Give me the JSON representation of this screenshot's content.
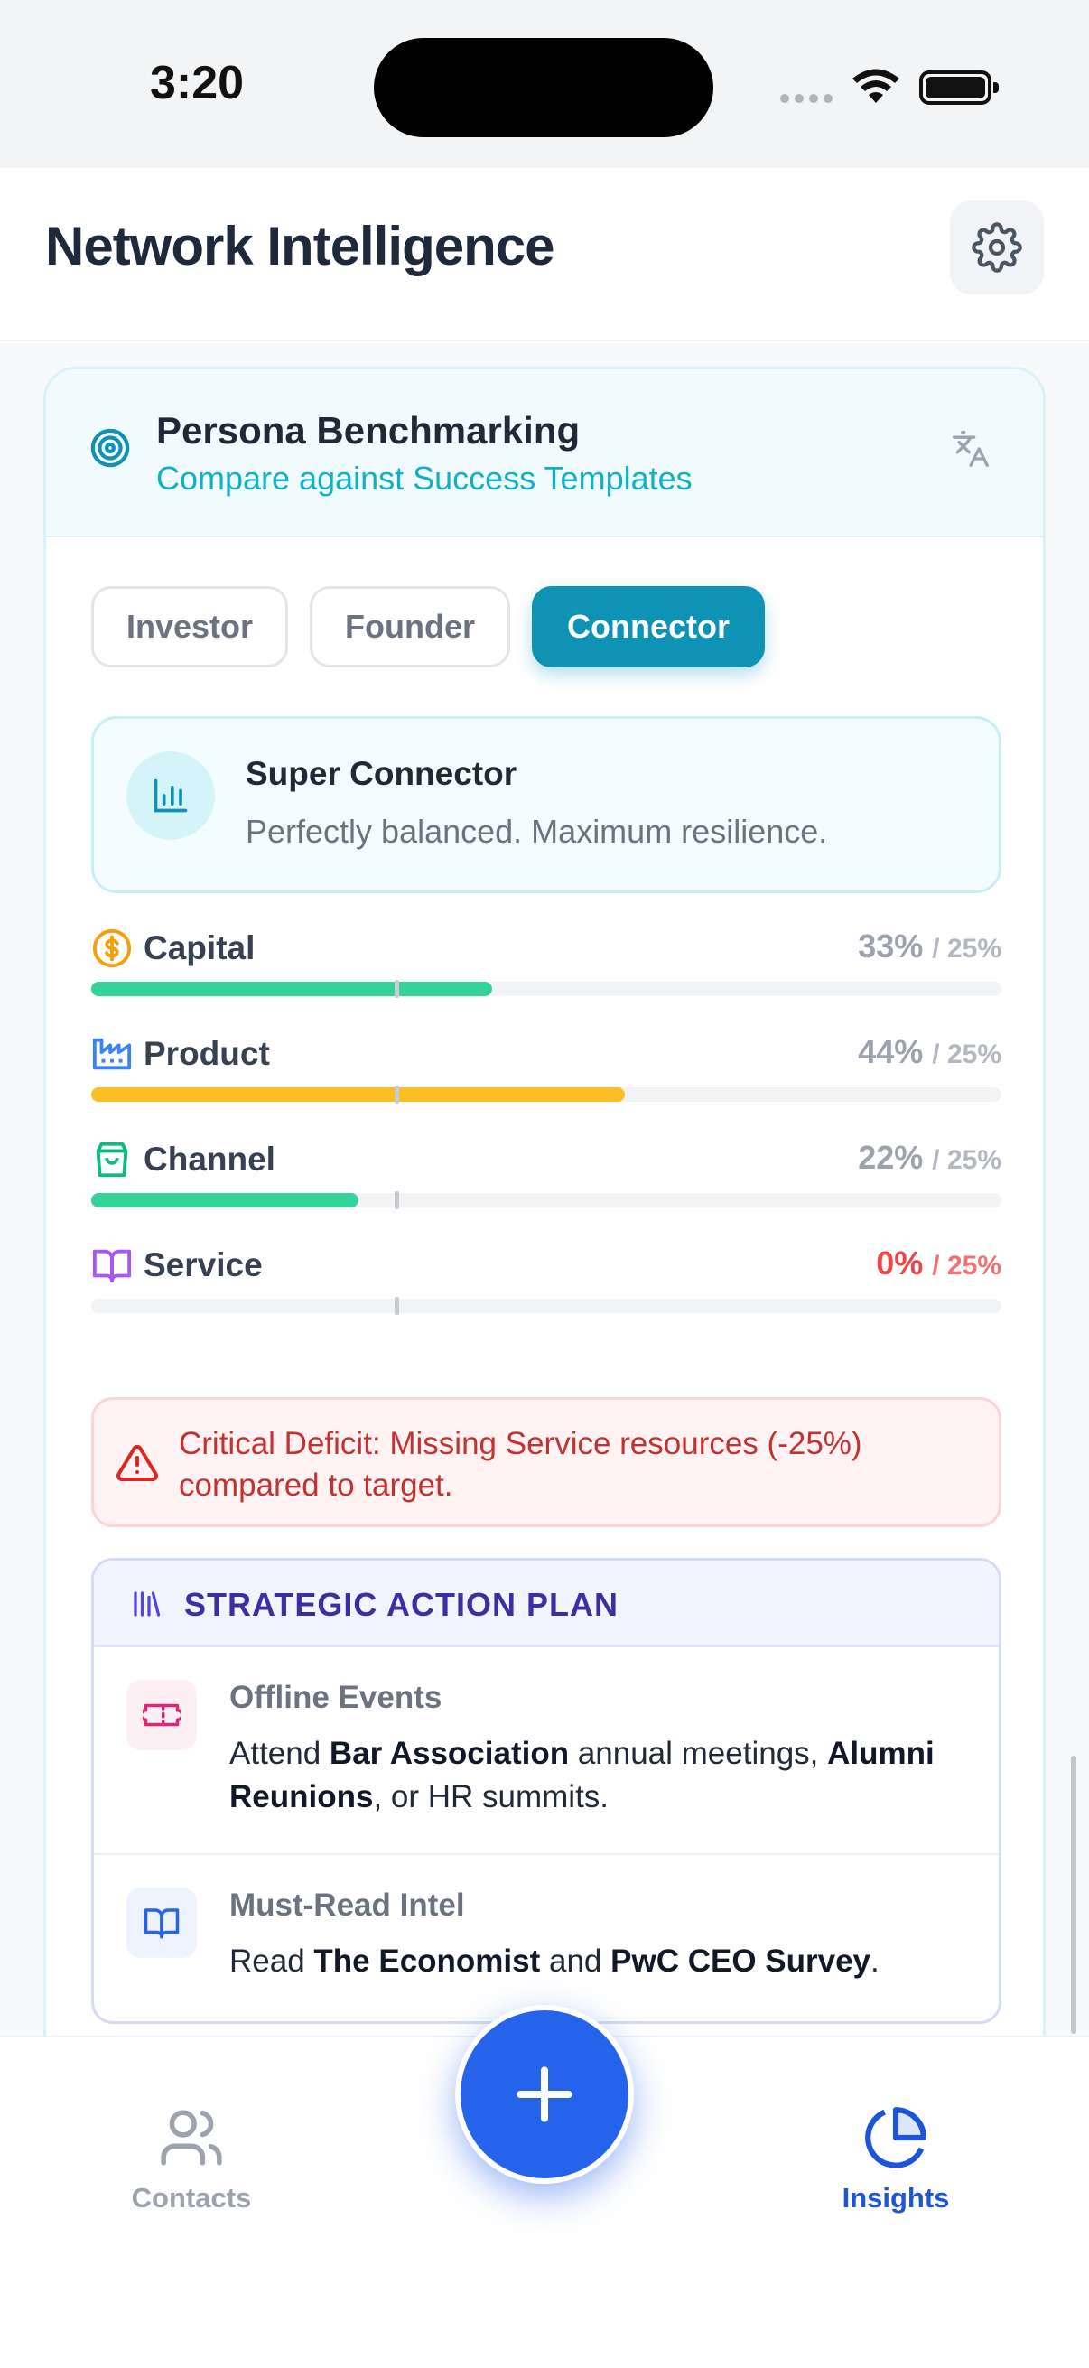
{
  "status_bar": {
    "time": "3:20"
  },
  "header": {
    "title": "Network Intelligence",
    "settings_icon": "gear-icon"
  },
  "card": {
    "title": "Persona Benchmarking",
    "subtitle": "Compare against Success Templates",
    "header_icon": "target-icon",
    "action_icon": "translate-icon",
    "tabs": [
      {
        "label": "Investor",
        "active": false
      },
      {
        "label": "Founder",
        "active": false
      },
      {
        "label": "Connector",
        "active": true
      }
    ],
    "profile": {
      "icon": "bar-chart-icon",
      "title": "Super Connector",
      "description": "Perfectly balanced. Maximum resilience."
    },
    "metrics": [
      {
        "label": "Capital",
        "icon": "dollar-icon",
        "value": "33%",
        "target": "/ 25%",
        "value_num": 33,
        "target_num": 25,
        "bar_color": "#34d399",
        "icon_color": "#f59e0b",
        "deficit": false
      },
      {
        "label": "Product",
        "icon": "factory-icon",
        "value": "44%",
        "target": "/ 25%",
        "value_num": 44,
        "target_num": 25,
        "bar_color": "#fbbf24",
        "icon_color": "#3b82f6",
        "deficit": false
      },
      {
        "label": "Channel",
        "icon": "shopping-bag-icon",
        "value": "22%",
        "target": "/ 25%",
        "value_num": 22,
        "target_num": 25,
        "bar_color": "#34d399",
        "icon_color": "#10b981",
        "deficit": false
      },
      {
        "label": "Service",
        "icon": "book-open-icon",
        "value": "0%",
        "target": "/ 25%",
        "value_num": 0,
        "target_num": 25,
        "bar_color": "#34d399",
        "icon_color": "#a855f7",
        "deficit": true
      }
    ],
    "alert": {
      "icon": "warning-icon",
      "text": "Critical Deficit: Missing Service resources (-25%) compared to target."
    },
    "action_plan": {
      "title": "STRATEGIC ACTION PLAN",
      "icon": "library-icon",
      "items": [
        {
          "icon": "ticket-icon",
          "title": "Offline Events",
          "parts": [
            "Attend ",
            "Bar Association",
            " annual meetings, ",
            "Alumni Reunions",
            ", or HR summits."
          ]
        },
        {
          "icon": "book-icon",
          "title": "Must-Read Intel",
          "parts": [
            "Read ",
            "The Economist",
            " and ",
            "PwC CEO Survey",
            "."
          ]
        }
      ]
    }
  },
  "bottom_nav": {
    "contacts_label": "Contacts",
    "insights_label": "Insights",
    "fab_icon": "plus-icon",
    "contacts_icon": "users-icon",
    "insights_icon": "pie-chart-icon"
  },
  "colors": {
    "accent": "#0e93b5",
    "primary": "#2563eb",
    "deficit": "#ef4444"
  }
}
